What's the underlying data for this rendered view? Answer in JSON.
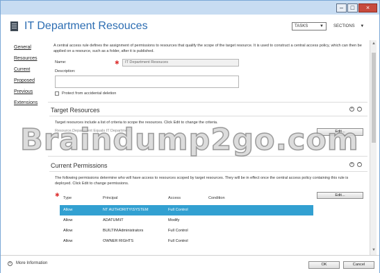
{
  "window": {
    "minimize": "–",
    "maximize": "□",
    "close": "×"
  },
  "header": {
    "title": "IT Department Resouces",
    "tasks_label": "TASKS",
    "sections_label": "SECTIONS"
  },
  "nav": [
    "General",
    "Resources",
    "Current",
    "Proposed",
    "Previous",
    "Extensions"
  ],
  "general": {
    "description_text": "A central access rule defines the assignment of permissions to resources that qualify the scope of the target resource. It is used to construct a central access policy, which can then be applied on a resource, such as a folder, after it is published.",
    "name_label": "Name:",
    "name_value": "IT Department Resouces",
    "description_label": "Description:",
    "protect_label": "Protect from accidental deletion"
  },
  "target_resources": {
    "title": "Target Resources",
    "text": "Target resources include a list of criteria to scope the resources. Click Edit to change the criteria.",
    "obscured_row": "Resource.Department Equals IT Department",
    "edit_label": "Edit..."
  },
  "current_permissions": {
    "title": "Current Permissions",
    "text": "The following permissions determine who will have access to resources scoped by target resources. They will be in effect once the central access policy containing this rule is deployed. Click Edit to change permissions.",
    "edit_label": "Edit...",
    "columns": [
      "Type",
      "Principal",
      "Access",
      "Condition"
    ],
    "rows": [
      {
        "type": "Allow",
        "principal": "NT AUTHORITY\\SYSTEM",
        "access": "Full Control",
        "condition": ""
      },
      {
        "type": "Allow",
        "principal": "ADATUM\\IT",
        "access": "Modify",
        "condition": ""
      },
      {
        "type": "Allow",
        "principal": "BUILTIN\\Administrators",
        "access": "Full Control",
        "condition": ""
      },
      {
        "type": "Allow",
        "principal": "OWNER RIGHTS",
        "access": "Full Control",
        "condition": ""
      }
    ]
  },
  "footer": {
    "more_info": "More Information",
    "ok": "OK",
    "cancel": "Cancel"
  },
  "watermark": "Braindump2go.com"
}
